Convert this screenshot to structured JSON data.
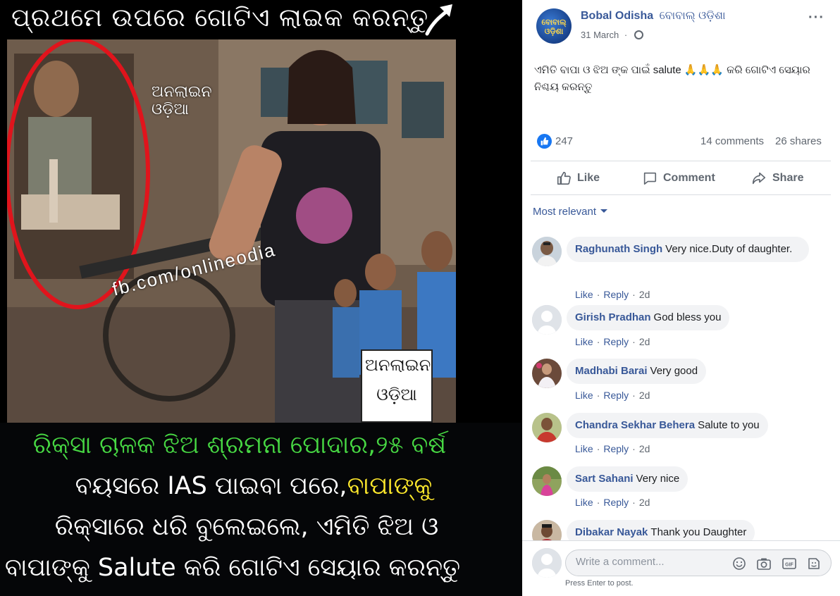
{
  "photo": {
    "top_caption": "ପ୍ରଥମେ ଉପରେ ଗୋଟିଏ ଲାଇକ କରନ୍ତୁ",
    "watermark_site": "fb.com/onlineodia",
    "watermark_logo_1": "ଅନଲାଇନ",
    "watermark_logo_2": "ଓଡ଼ିଆ",
    "bottom_lines": [
      "ରିକ୍ସା ଚାଳକ ଝିଅ ଶ୍ରମନା ପୋଦାର,୨୫ ବର୍ଷ",
      "ବୟସରେ IAS ପାଇବା ପରେ,ବାପାଙ୍କୁ",
      "ରିକ୍ସାରେ ଧରି ବୁଲେଇଲେ, ଏମିତି ଝିଅ ଓ",
      "ବାପାଙ୍କୁ Salute କରି ଗୋଟିଏ ସେୟାର କରନ୍ତୁ"
    ]
  },
  "post": {
    "page_name": "Bobal Odisha",
    "page_name_odia": "ବୋବାଲ୍ ଓଡ଼ିଶା",
    "time": "31 March",
    "text": "ଏମିତି ବାପା ଓ ଝିଅ ଙ୍କ ପାଇଁ salute 🙏🙏🙏 କରି ଗୋଟିଏ ସେୟାର ନିଶ୍ଚୟ କରନ୍ତୁ",
    "reactions": "247",
    "comments_count": "14 comments",
    "shares_count": "26 shares",
    "actions": {
      "like": "Like",
      "comment": "Comment",
      "share": "Share"
    }
  },
  "sort_label": "Most relevant",
  "comments": [
    {
      "name": "Raghunath Singh",
      "text": "Very nice.Duty of daughter.",
      "age": "2d"
    },
    {
      "name": "Girish Pradhan",
      "text": "God bless you",
      "age": "2d"
    },
    {
      "name": "Madhabi Barai",
      "text": "Very good",
      "age": "2d"
    },
    {
      "name": "Chandra Sekhar Behera",
      "text": "Salute to you",
      "age": "2d"
    },
    {
      "name": "Sart Sahani",
      "text": "Very nice",
      "age": "2d"
    },
    {
      "name": "Dibakar Nayak",
      "text": "Thank you Daughter",
      "age": ""
    }
  ],
  "comment_action_like": "Like",
  "comment_action_reply": "Reply",
  "composer": {
    "placeholder": "Write a comment...",
    "hint": "Press Enter to post."
  },
  "colors": {
    "fb_blue": "#385898",
    "like_blue": "#1877f2",
    "odia_green": "#47d843",
    "odia_yellow": "#ffe92c"
  }
}
